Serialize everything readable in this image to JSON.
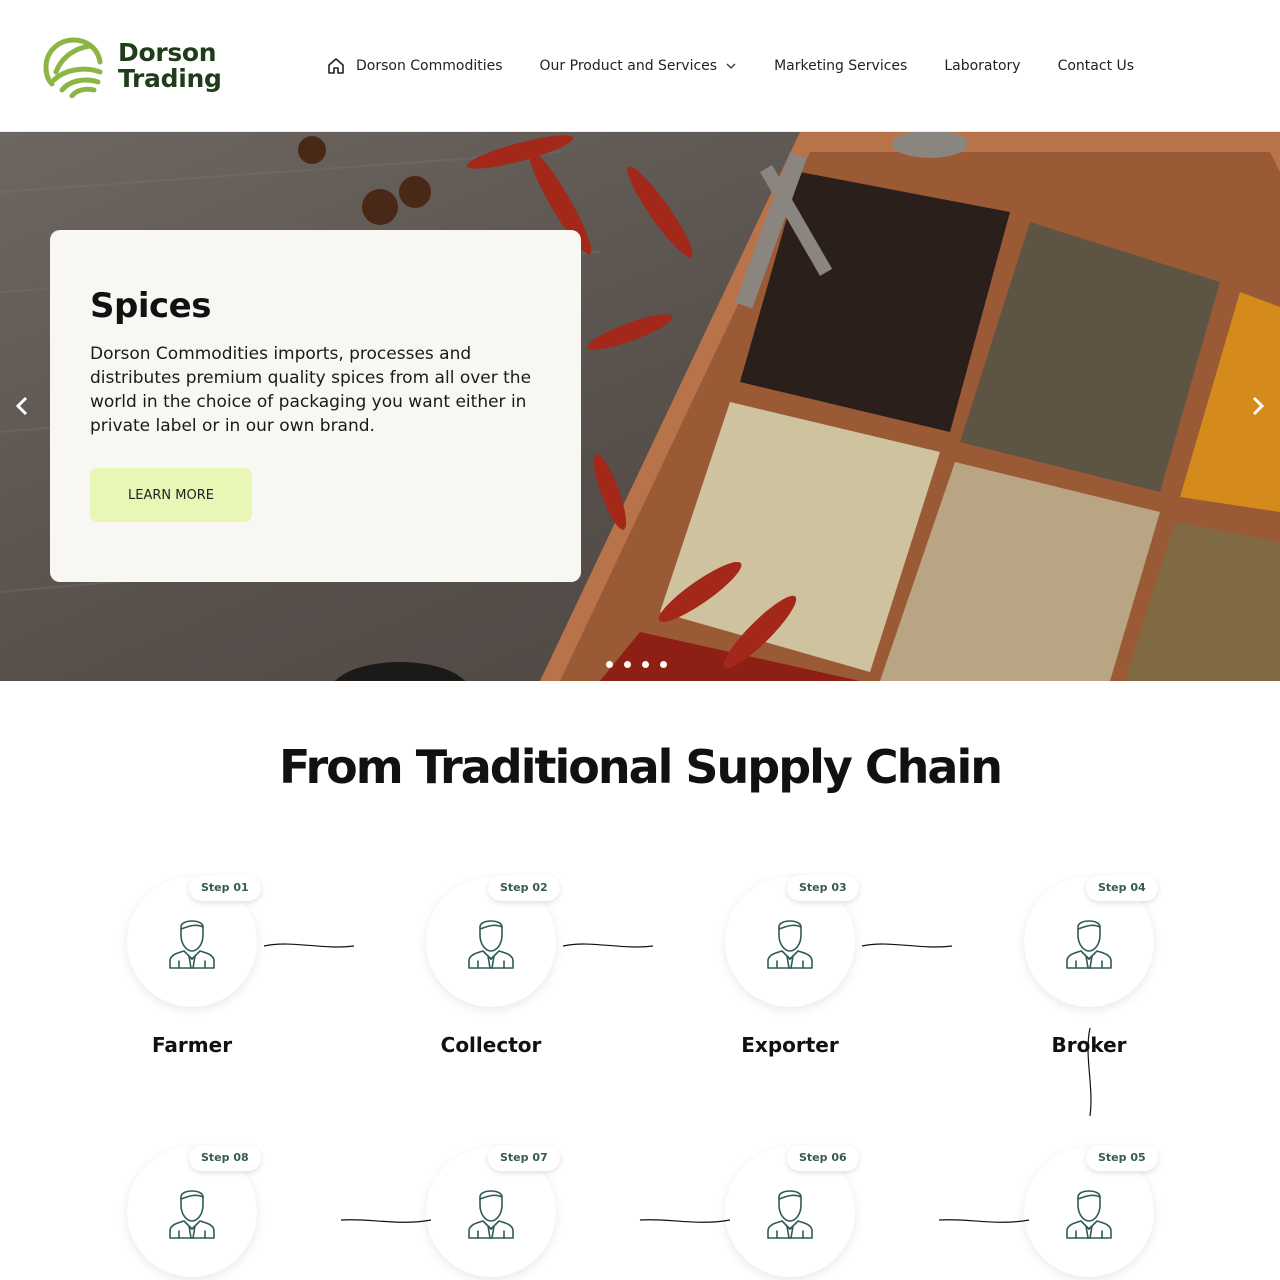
{
  "header": {
    "logo_line1": "Dorson",
    "logo_line2": "Trading",
    "nav": [
      {
        "label": "Dorson Commodities",
        "icon": "home-icon"
      },
      {
        "label": "Our Product and Services",
        "icon": "chevron-down-icon"
      },
      {
        "label": "Marketing Services"
      },
      {
        "label": "Laboratory"
      },
      {
        "label": "Contact Us"
      }
    ]
  },
  "hero": {
    "title": "Spices",
    "description": "Dorson Commodities imports, processes and distributes premium quality spices from all over the world in the choice of packaging you want either in private label or in our own brand.",
    "button_label": "LEARN MORE",
    "slide_count": 4,
    "button_color": "#e8f6b6"
  },
  "supply_chain": {
    "title": "From Traditional Supply Chain",
    "steps": [
      {
        "badge": "Step 01",
        "label": "Farmer"
      },
      {
        "badge": "Step 02",
        "label": "Collector"
      },
      {
        "badge": "Step 03",
        "label": "Exporter"
      },
      {
        "badge": "Step 04",
        "label": "Broker"
      },
      {
        "badge": "Step 05",
        "label": ""
      },
      {
        "badge": "Step 06",
        "label": ""
      },
      {
        "badge": "Step 07",
        "label": ""
      },
      {
        "badge": "Step 08",
        "label": ""
      }
    ],
    "icon_color": "#2f5b57"
  },
  "colors": {
    "logo_green": "#8db544",
    "logo_dark": "#1f3d1a",
    "badge_text": "#375a55"
  }
}
